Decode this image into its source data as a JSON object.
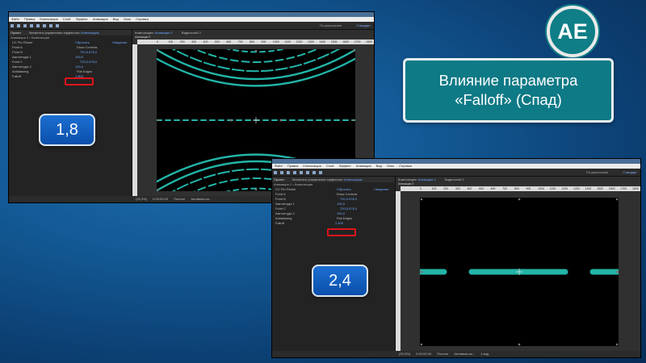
{
  "logo": {
    "text": "AE"
  },
  "title": {
    "line1": "Влияние параметра",
    "line2": "«Falloff» (Спад)"
  },
  "badges": {
    "first": "1,8",
    "second": "2,4"
  },
  "app": {
    "menu": [
      "Файл",
      "Правка",
      "Композиция",
      "Слой",
      "Эффект",
      "Анимация",
      "Вид",
      "Окно",
      "Справка"
    ],
    "workspace_label": "По умолчанию",
    "workspace_button": "Стандарт"
  },
  "effect_controls": {
    "tab_project": "Проект",
    "tab_controls": "Элементы управления эффектом:",
    "tab_link": "Композиция",
    "breadcrumb": "Анимация 2 • Композиция",
    "effect_name": "CC Pin Flicker",
    "effect_reset": "Сбросить",
    "effect_about": "Сведения",
    "properties": [
      {
        "name": "Point A",
        "value": "Draw Controls"
      },
      {
        "name": "Point B",
        "value": "720,0,576,0"
      },
      {
        "name": "Амплитуда 1",
        "value": "100,0"
      },
      {
        "name": "Point C",
        "value": "720,0,576,0"
      },
      {
        "name": "Амплитуда 2",
        "value": "100,0"
      },
      {
        "name": "Antialiasing",
        "value": "Flat Edges"
      },
      {
        "name": "Falloff",
        "value": "1,800"
      }
    ],
    "falloff_value_second": "2,400"
  },
  "viewer": {
    "tab_comp": "Композиция:",
    "tab_comp_link": "Анимация 2",
    "tab_layer": "Видеослой 2",
    "subtab": "Анимация 2",
    "ruler_ticks": [
      "0",
      "100",
      "200",
      "300",
      "400",
      "500",
      "600",
      "700",
      "800",
      "900",
      "1000",
      "1100",
      "1200",
      "1300",
      "1400",
      "1500",
      "1600",
      "1700",
      "1800"
    ],
    "footer": [
      "(33,3%)",
      "0:00:00:00",
      "Полное",
      "Активная ка...",
      "1 вид"
    ]
  }
}
